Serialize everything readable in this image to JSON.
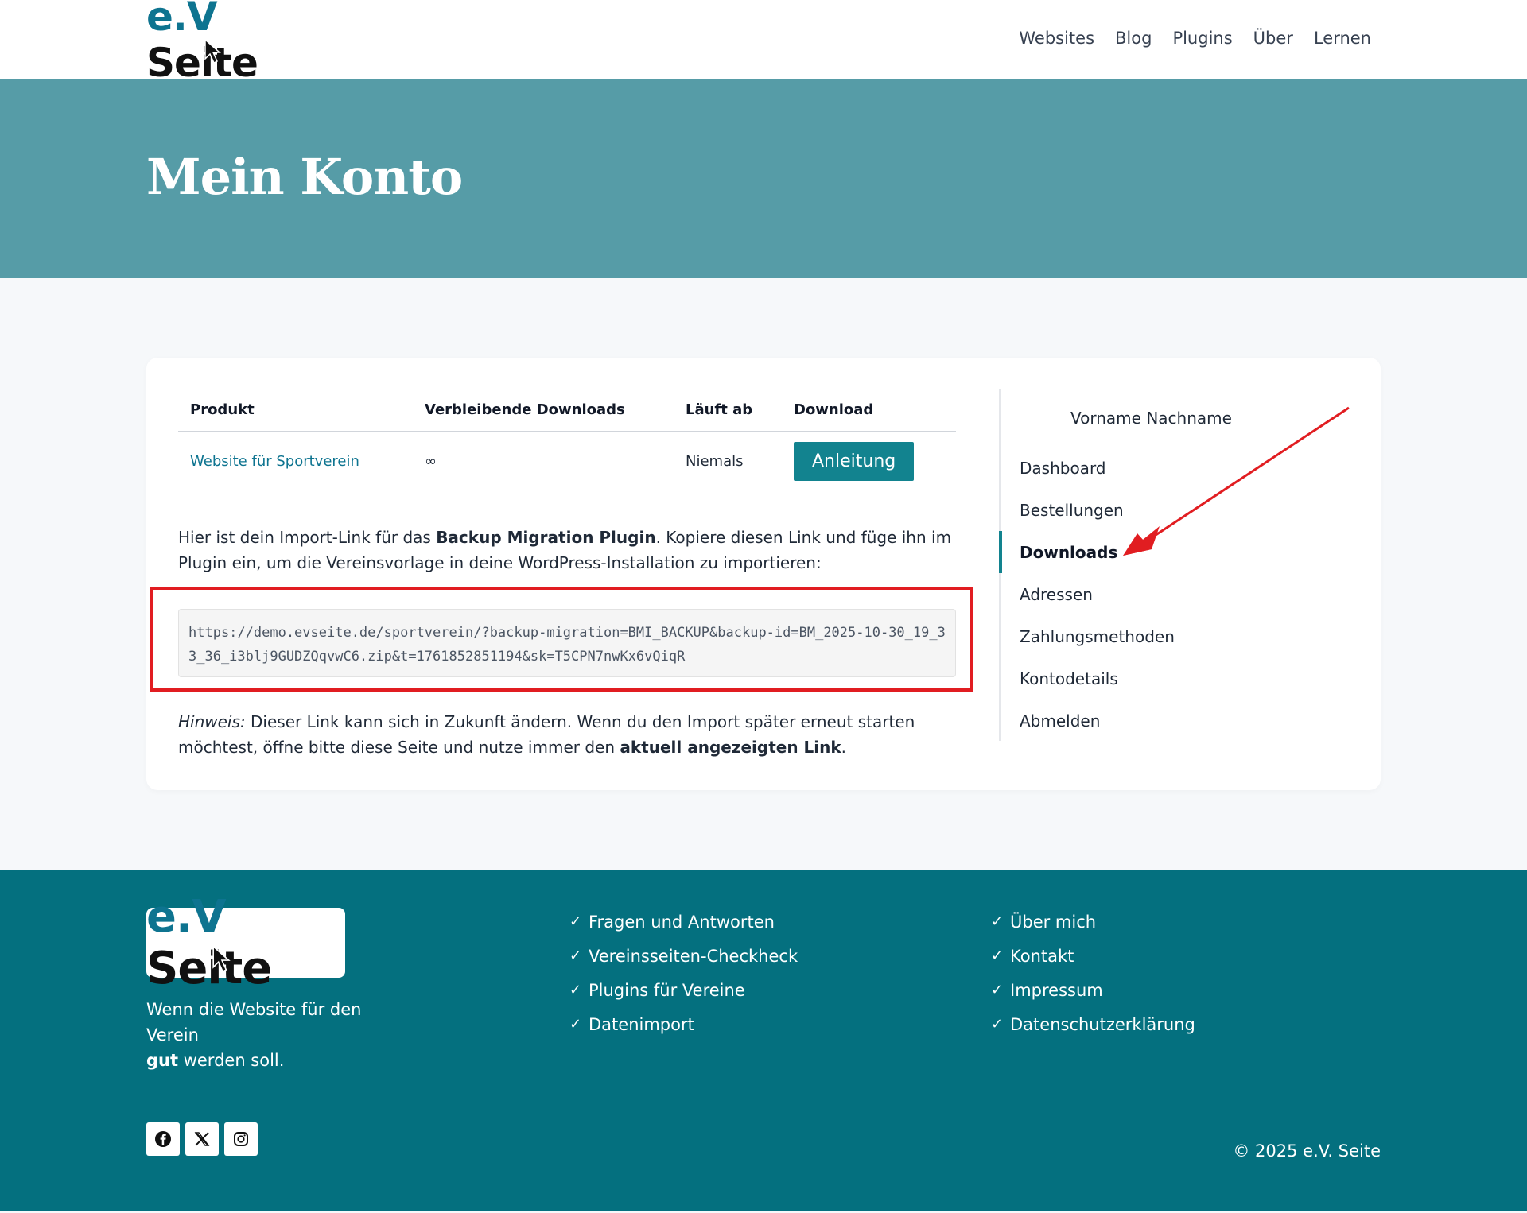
{
  "header": {
    "logo_alt": "e.V. Seite",
    "nav": [
      "Websites",
      "Blog",
      "Plugins",
      "Über",
      "Lernen"
    ]
  },
  "hero": {
    "title": "Mein Konto"
  },
  "downloads_table": {
    "headers": [
      "Produkt",
      "Verbleibende Downloads",
      "Läuft ab",
      "Download"
    ],
    "rows": [
      {
        "product": "Website für Sportverein",
        "remaining": "∞",
        "expires": "Niemals",
        "button": "Anleitung"
      }
    ]
  },
  "intro": {
    "before": "Hier ist dein Import-Link für das ",
    "bold": "Backup Migration Plugin",
    "after": ". Kopiere diesen Link und füge ihn im Plugin ein, um die Vereinsvorlage in deine WordPress-Installation zu importieren:"
  },
  "import_link": "https://demo.evseite.de/sportverein/?backup-migration=BMI_BACKUP&backup-id=BM_2025-10-30_19_33_36_i3blj9GUDZQqvwC6.zip&t=1761852851194&sk=T5CPN7nwKx6vQiqR",
  "note": {
    "italic": "Hinweis:",
    "text": " Dieser Link kann sich in Zukunft ändern. Wenn du den Import später erneut starten möchtest, öffne bitte diese Seite und nutze immer den ",
    "bold": "aktuell angezeigten Link",
    "end": "."
  },
  "account_nav": {
    "user": "Vorname Nachname",
    "items": [
      "Dashboard",
      "Bestellungen",
      "Downloads",
      "Adressen",
      "Zahlungsmethoden",
      "Kontodetails",
      "Abmelden"
    ],
    "active": "Downloads"
  },
  "footer": {
    "tagline_1": "Wenn die Website für den Verein ",
    "tagline_bold": "gut",
    "tagline_2": " werden soll.",
    "col1": [
      "Fragen und Antworten",
      "Vereinsseiten-Checkheck",
      "Plugins für Vereine",
      "Datenimport"
    ],
    "col2": [
      "Über mich",
      "Kontakt",
      "Impressum",
      "Datenschutzerklärung"
    ],
    "social_icons": [
      "facebook-icon",
      "x-icon",
      "instagram-icon"
    ],
    "copyright": "© 2025 e.V. Seite"
  },
  "colors": {
    "hero": "#569ca7",
    "footer": "#04707f",
    "accent": "#12838f",
    "highlight": "#e11d21"
  }
}
